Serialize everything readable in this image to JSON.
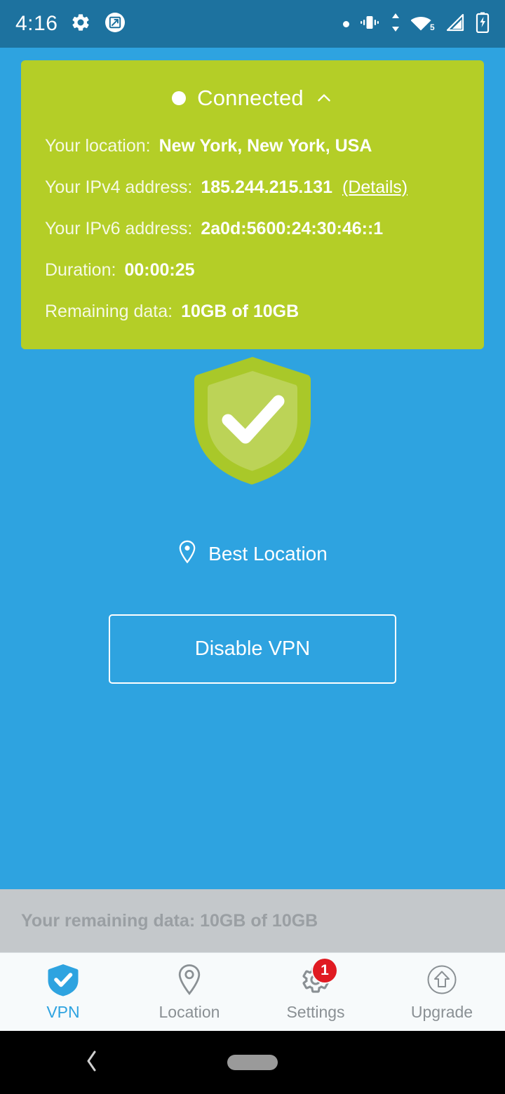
{
  "status_bar": {
    "time": "4:16",
    "left_icons": [
      "gear-icon",
      "screenshot-icon"
    ],
    "right_icons": [
      "dot-indicator",
      "vibrate-icon",
      "data-transfer-icon",
      "wifi-icon",
      "cellular-signal-icon",
      "battery-charging-icon"
    ],
    "wifi_level": "5",
    "background_color": "#1d729f"
  },
  "connection_card": {
    "status_label": "Connected",
    "status_dot": "connected-dot",
    "collapse_icon": "chevron-up-icon",
    "background_color": "#b4ce27",
    "rows": [
      {
        "label": "Your location:",
        "value": "New York, New York, USA"
      },
      {
        "label": "Your IPv4 address:",
        "value": "185.244.215.131",
        "link": "(Details)"
      },
      {
        "label": "Your IPv6 address:",
        "value": "2a0d:5600:24:30:46::1"
      },
      {
        "label": "Duration:",
        "value": "00:00:25"
      },
      {
        "label": "Remaining data:",
        "value": "10GB of 10GB"
      }
    ]
  },
  "main": {
    "shield_icon": "shield-check-icon",
    "shield_outer_color": "#a9c829",
    "shield_inner_color": "#bcd357",
    "location_icon": "map-pin-icon",
    "location_label": "Best Location",
    "disable_button_label": "Disable VPN",
    "background_color": "#2ea3e0"
  },
  "data_banner": {
    "text": "Your remaining data: 10GB of 10GB",
    "background_color": "#c4c8cb",
    "text_color": "#9a9fa3"
  },
  "tabs": [
    {
      "label": "VPN",
      "icon": "shield-check-icon",
      "active": true,
      "badge": null
    },
    {
      "label": "Location",
      "icon": "map-pin-icon",
      "active": false,
      "badge": null
    },
    {
      "label": "Settings",
      "icon": "gear-icon",
      "active": false,
      "badge": "1"
    },
    {
      "label": "Upgrade",
      "icon": "arrow-up-circle-icon",
      "active": false,
      "badge": null
    }
  ],
  "nav_bar": {
    "back_icon": "back-chevron-icon",
    "home_icon": "home-pill-icon"
  }
}
